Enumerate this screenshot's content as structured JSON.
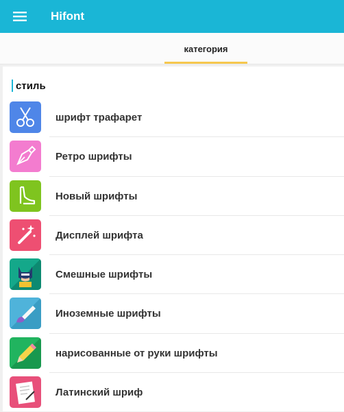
{
  "app": {
    "title": "Hifont"
  },
  "tabs": [
    {
      "label": "категория"
    }
  ],
  "section": {
    "title": "стиль"
  },
  "categories": [
    {
      "label": "шрифт трафарет",
      "icon": "scissors-icon",
      "color": "#4f86e8"
    },
    {
      "label": "Ретро шрифты",
      "icon": "fountain-pen-icon",
      "color": "#f37ccf"
    },
    {
      "label": "Новый шрифты",
      "icon": "high-heel-shoe-icon",
      "color": "#7fc41f"
    },
    {
      "label": "Дисплей шрифта",
      "icon": "magic-wand-icon",
      "color": "#ee4f72"
    },
    {
      "label": "Смешные шрифты",
      "icon": "masked-hero-icon",
      "color": "#14a88a"
    },
    {
      "label": "Иноземные шрифты",
      "icon": "paintbrush-icon",
      "color": "#4fb3da"
    },
    {
      "label": "нарисованные от руки шрифты",
      "icon": "pencil-icon",
      "color": "#21b45f"
    },
    {
      "label": "Латинский шриф",
      "icon": "writing-hand-icon",
      "color": "#e8507a"
    }
  ],
  "colors": {
    "appbar": "#1ab6d6",
    "tab_indicator": "#f6c84e"
  }
}
